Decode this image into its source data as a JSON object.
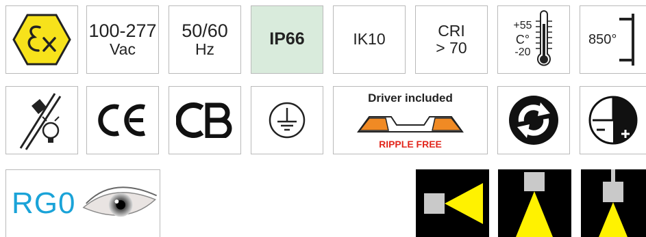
{
  "tiles": {
    "voltage": {
      "line1": "100-277",
      "line2": "Vac"
    },
    "frequency": {
      "line1": "50/60",
      "line2": "Hz"
    },
    "ip_rating": {
      "label": "IP66",
      "fill": "#d9ebdc"
    },
    "ik_rating": {
      "label": "IK10"
    },
    "cri": {
      "line1": "CRI",
      "line2": "> 70"
    },
    "temperature": {
      "max": "+55",
      "unit": "C°",
      "min": "-20"
    },
    "glow_wire": {
      "label": "850°"
    },
    "ce": {
      "label": "CE"
    },
    "cb": {
      "label": "CB"
    },
    "driver": {
      "title": "Driver included",
      "subtitle": "RIPPLE FREE"
    },
    "rg0": {
      "label": "RG0"
    }
  },
  "colors": {
    "atex_yellow": "#f7e21b",
    "driver_orange": "#f08a24",
    "ripple_red": "#e2261c",
    "rg_blue": "#1aa3d8",
    "beam_yellow": "#fff200",
    "fixture_grey": "#c9c9c9"
  },
  "icons": [
    "atex-ex-icon",
    "thermometer-icon",
    "glow-wire-icon",
    "no-hot-lamp-icon",
    "earth-ground-icon",
    "recycle-icon",
    "dimmable-icon",
    "beam-side-icon",
    "beam-down-icon",
    "beam-down-pendant-icon"
  ]
}
